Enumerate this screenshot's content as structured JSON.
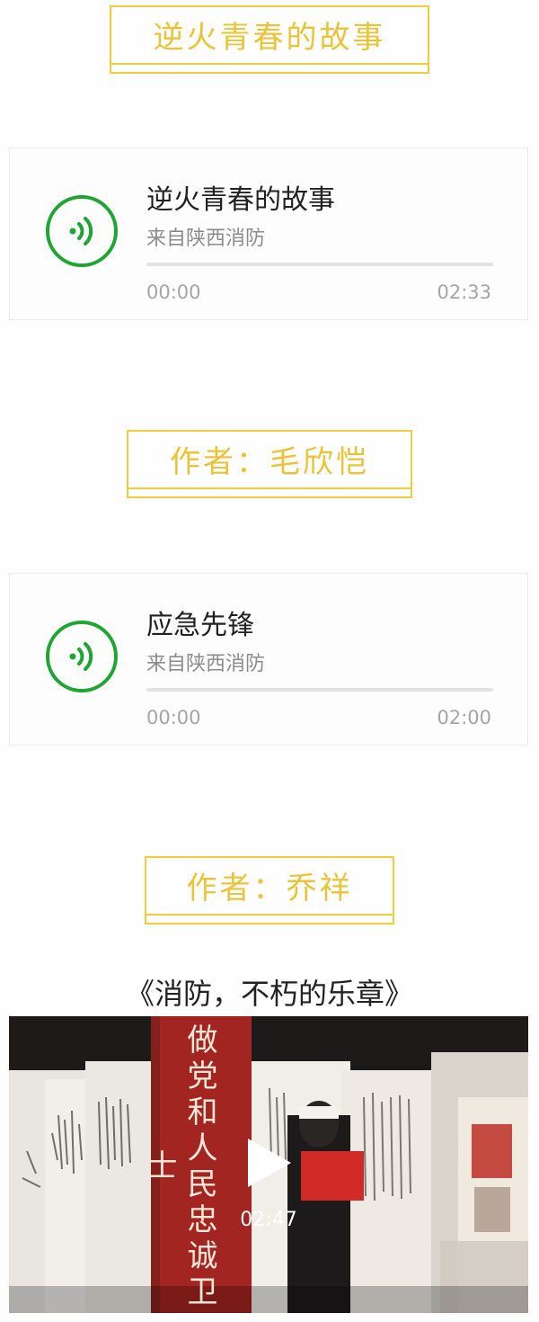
{
  "sections": [
    {
      "banner": "逆火青春的故事"
    },
    {
      "banner": "作者：毛欣恺"
    },
    {
      "banner": "作者：乔祥"
    }
  ],
  "audio_cards": [
    {
      "title": "逆火青春的故事",
      "source": "来自陕西消防",
      "current_time": "00:00",
      "duration": "02:33",
      "progress": 0,
      "icon": "audio-wave-icon"
    },
    {
      "title": "应急先锋",
      "source": "来自陕西消防",
      "current_time": "00:00",
      "duration": "02:00",
      "progress": 0,
      "icon": "audio-wave-icon"
    }
  ],
  "video": {
    "title": "《消防，不朽的乐章》",
    "duration": "02:47",
    "banner_text": "做党和人民忠诚卫士",
    "icon": "play-icon"
  },
  "colors": {
    "accent_gold": "#f0cd3a",
    "accent_green": "#1fa533"
  }
}
